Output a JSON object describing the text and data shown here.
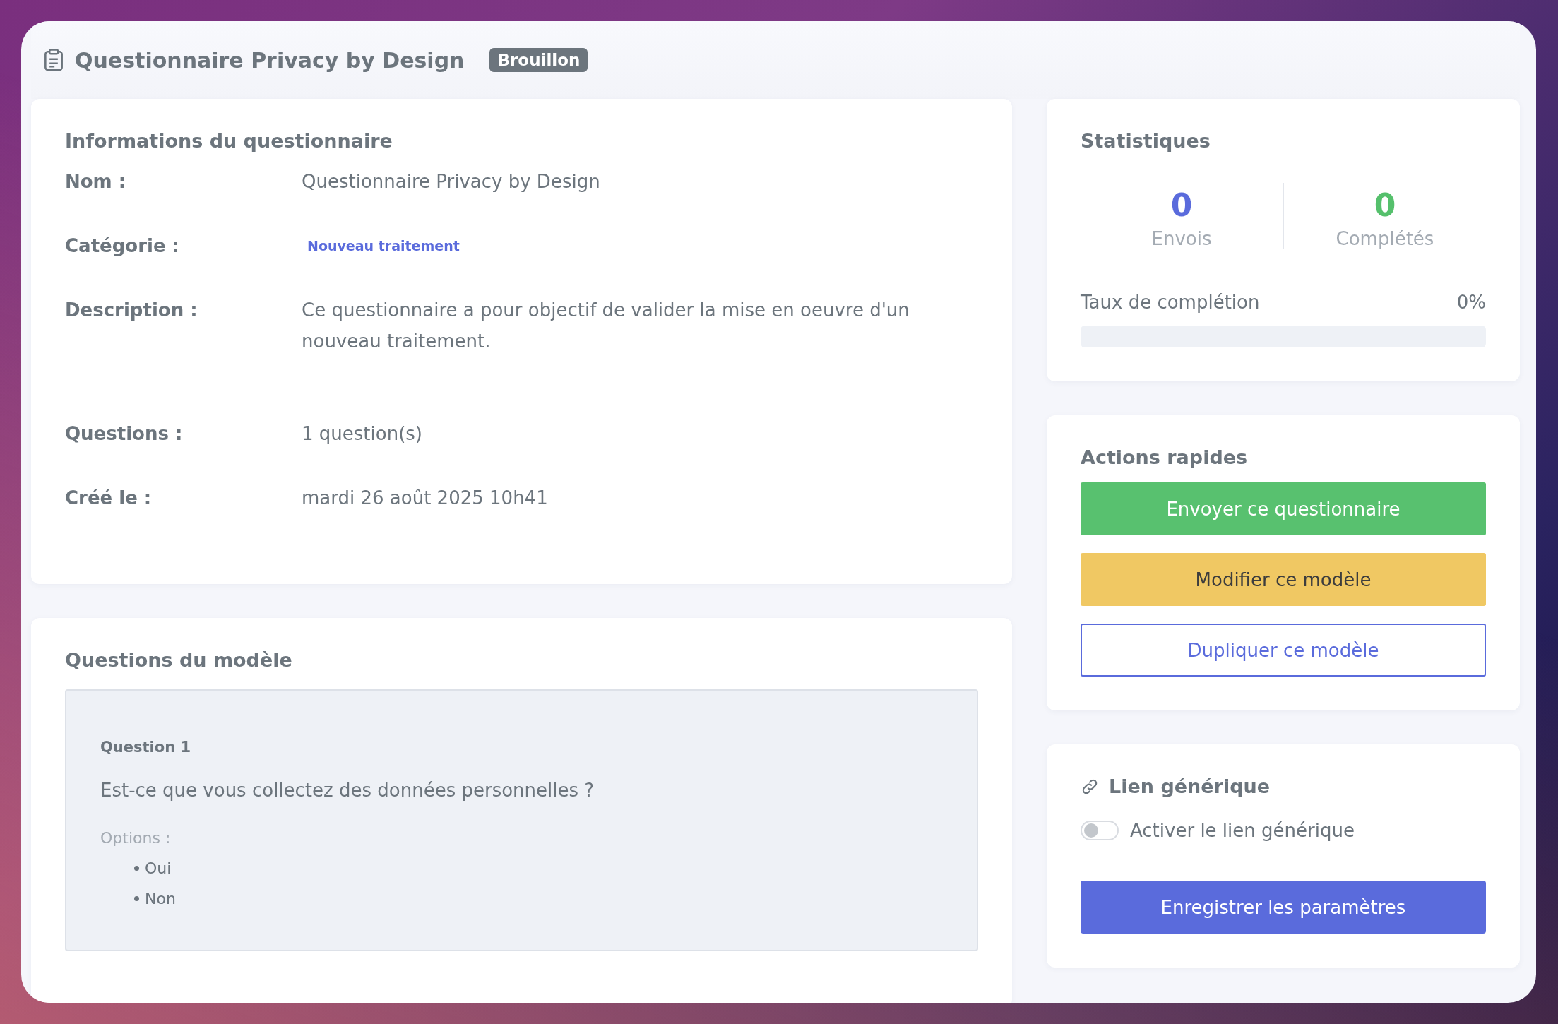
{
  "header": {
    "title": "Questionnaire Privacy by Design",
    "status": "Brouillon"
  },
  "info": {
    "heading": "Informations du questionnaire",
    "fields": [
      {
        "label": "Nom :",
        "value": "Questionnaire Privacy by Design",
        "kind": "text"
      },
      {
        "label": "Catégorie :",
        "value": "Nouveau traitement",
        "kind": "tag"
      },
      {
        "label": "Description :",
        "value": "Ce questionnaire a pour objectif de valider la mise en oeuvre d'un nouveau traitement.",
        "kind": "paragraph"
      },
      {
        "label": "Questions :",
        "value": "1 question(s)",
        "kind": "text"
      },
      {
        "label": "Créé le :",
        "value": "mardi 26 août 2025 10h41",
        "kind": "text"
      }
    ]
  },
  "questions": {
    "heading": "Questions du modèle",
    "items": [
      {
        "title": "Question 1",
        "text": "Est-ce que vous collectez des données personnelles ?",
        "options_label": "Options :",
        "options": [
          "Oui",
          "Non"
        ]
      }
    ]
  },
  "statistics": {
    "heading": "Statistiques",
    "counters": [
      {
        "value": "0",
        "label": "Envois",
        "color": "#5a6bdc"
      },
      {
        "value": "0",
        "label": "Complétés",
        "color": "#55c06c"
      }
    ],
    "completion": {
      "label": "Taux de complétion",
      "reading": "0%",
      "level": 0
    }
  },
  "quick_actions": {
    "heading": "Actions rapides",
    "buttons": [
      {
        "label": "Envoyer ce questionnaire",
        "kind": "success"
      },
      {
        "label": "Modifier ce modèle",
        "kind": "warning"
      },
      {
        "label": "Dupliquer ce modèle",
        "kind": "outline"
      }
    ]
  },
  "generic_link": {
    "heading": "Lien générique",
    "toggle": {
      "label": "Activer le lien générique",
      "on": false
    },
    "save_button": "Enregistrer les paramètres"
  }
}
